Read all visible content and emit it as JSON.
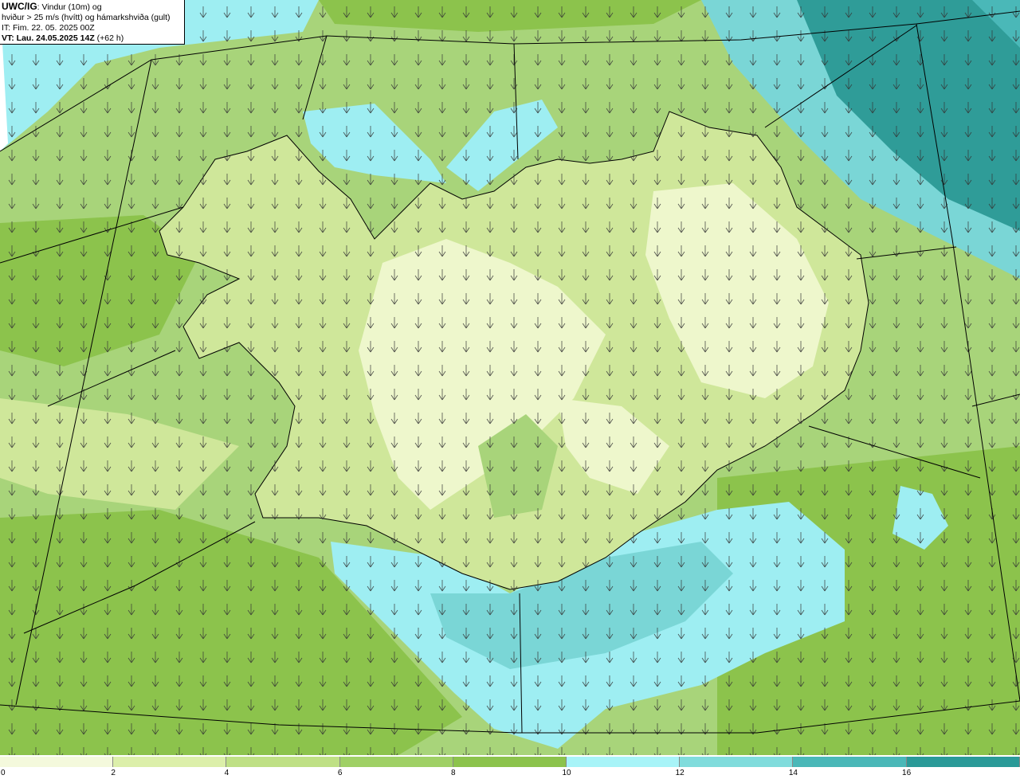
{
  "info": {
    "model": "UWC/IG",
    "title_rest": ": Vindur (10m) og",
    "line2": "hviður > 25 m/s (hvítt) og hámarkshviða (gult)",
    "line3": "IT: Fim. 22. 05. 2025 00Z",
    "line4_bold": "VT: Lau. 24.05.2025 14Z",
    "line4_rest": " (+62 h)"
  },
  "legend": {
    "ticks": [
      "0",
      "2",
      "4",
      "6",
      "8",
      "10",
      "12",
      "14",
      "16"
    ],
    "colors": [
      "#f4f9dc",
      "#dcefaa",
      "#bfe085",
      "#9fd065",
      "#8cc34c",
      "#a8f4f8",
      "#80dcdc",
      "#4ab8b8",
      "#2a9a98",
      "#c0a8f4"
    ]
  },
  "map_colors": {
    "land_light": "#eef7cc",
    "land_mid": "#cfe79a",
    "sea_mid": "#a8d47a",
    "sea_dark": "#8cc34c",
    "cyan_light": "#9eeef2",
    "cyan_mid": "#7ad6d6",
    "teal_dark": "#2f9c98",
    "coast": "#000000",
    "graticule": "#000000",
    "arrow": "#333333"
  }
}
